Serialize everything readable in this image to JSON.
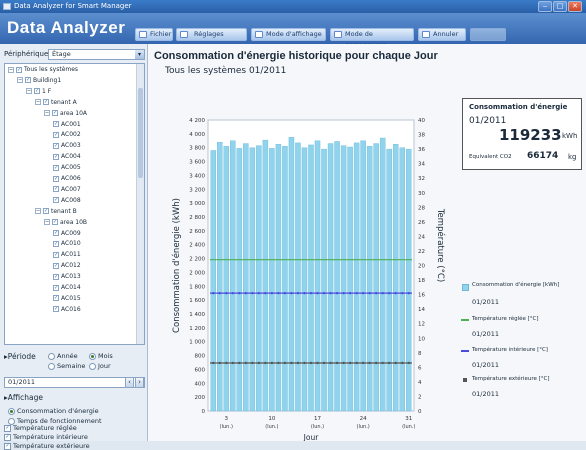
{
  "window": {
    "title": "Data Analyzer for Smart Manager"
  },
  "app": {
    "title": "Data Analyzer"
  },
  "toolbar": {
    "fichier": "Fichier",
    "reglages": "Réglages",
    "mode_affichage": "Mode d'affichage",
    "mode_comparaison": "Mode de comparaison",
    "annuler": "Annuler"
  },
  "sidebar": {
    "peripherique_label": "Périphérique",
    "peripherique_value": "Étage",
    "tree": [
      {
        "label": "Tous les systèmes",
        "level": 0
      },
      {
        "label": "Building1",
        "level": 1
      },
      {
        "label": "1 F",
        "level": 2
      },
      {
        "label": "tenant A",
        "level": 3
      },
      {
        "label": "area 10A",
        "level": 4
      },
      {
        "label": "AC001",
        "level": 5
      },
      {
        "label": "AC002",
        "level": 5
      },
      {
        "label": "AC003",
        "level": 5
      },
      {
        "label": "AC004",
        "level": 5
      },
      {
        "label": "AC005",
        "level": 5
      },
      {
        "label": "AC006",
        "level": 5
      },
      {
        "label": "AC007",
        "level": 5
      },
      {
        "label": "AC008",
        "level": 5
      },
      {
        "label": "tenant B",
        "level": 3
      },
      {
        "label": "area 10B",
        "level": 4
      },
      {
        "label": "AC009",
        "level": 5
      },
      {
        "label": "AC010",
        "level": 5
      },
      {
        "label": "AC011",
        "level": 5
      },
      {
        "label": "AC012",
        "level": 5
      },
      {
        "label": "AC013",
        "level": 5
      },
      {
        "label": "AC014",
        "level": 5
      },
      {
        "label": "AC015",
        "level": 5
      },
      {
        "label": "AC016",
        "level": 5
      }
    ],
    "periode_label": "Période",
    "periode_options": [
      "Année",
      "Mois",
      "Semaine",
      "Jour"
    ],
    "periode_selected": "Mois",
    "date_value": "01/2011",
    "affichage_label": "Affichage",
    "affichage_options": [
      "Consommation d'énergie",
      "Temps de fonctionnement"
    ],
    "affichage_selected": "Consommation d'énergie",
    "checkboxes": [
      {
        "label": "Température réglée",
        "checked": true
      },
      {
        "label": "Température intérieure",
        "checked": true
      },
      {
        "label": "Température extérieure",
        "checked": true
      }
    ]
  },
  "main": {
    "title": "Consommation d'énergie historique pour chaque Jour",
    "subtitle": "Tous les systèmes  01/2011"
  },
  "consumption_box": {
    "heading": "Consommation d'énergie",
    "period": "01/2011",
    "value": "119233",
    "unit": "kWh",
    "co2_label": "Equivalent CO2",
    "co2_value": "66174",
    "co2_unit": "kg"
  },
  "legend": [
    {
      "label": "Consommation d'énergie [kWh]",
      "date": "01/2011"
    },
    {
      "label": "Température réglée [°C]",
      "date": "01/2011"
    },
    {
      "label": "Température intérieure [°C]",
      "date": "01/2011"
    },
    {
      "label": "Température extérieure [°C]",
      "date": "01/2011"
    }
  ],
  "colors": {
    "bar": "#8fd3ec",
    "bar_edge": "#6fb9d8",
    "setpoint_line": "#4caf50",
    "indoor_line": "#4a4adf",
    "outdoor_line": "#555555",
    "header_blue": "#3f72b8"
  },
  "chart_data": {
    "type": "bar",
    "xlabel": "Jour",
    "ylabel": "Consommation d'énergie (kWh)",
    "y2label": "Température (°C)",
    "ylim": [
      0,
      4200
    ],
    "y2lim": [
      0,
      40
    ],
    "yticks": [
      "4 200",
      "4 000",
      "3 800",
      "3 600",
      "3 400",
      "3 200",
      "3 000",
      "2 800",
      "2 600",
      "2 400",
      "2 200",
      "2 000",
      "1 800",
      "1 600",
      "1 400",
      "1 200",
      "1 000",
      "800",
      "600",
      "400",
      "200",
      "0"
    ],
    "y2ticks": [
      "40",
      "38",
      "36",
      "34",
      "32",
      "30",
      "28",
      "26",
      "24",
      "22",
      "20",
      "18",
      "16",
      "14",
      "12",
      "10",
      "8",
      "6",
      "4",
      "2",
      "0"
    ],
    "xticks": [
      {
        "day": 3,
        "label": "3",
        "weekday": "(lun.)"
      },
      {
        "day": 10,
        "label": "10",
        "weekday": "(lun.)"
      },
      {
        "day": 17,
        "label": "17",
        "weekday": "(lun.)"
      },
      {
        "day": 24,
        "label": "24",
        "weekday": "(lun.)"
      },
      {
        "day": 31,
        "label": "31",
        "weekday": "(lun.)"
      }
    ],
    "categories": [
      1,
      2,
      3,
      4,
      5,
      6,
      7,
      8,
      9,
      10,
      11,
      12,
      13,
      14,
      15,
      16,
      17,
      18,
      19,
      20,
      21,
      22,
      23,
      24,
      25,
      26,
      27,
      28,
      29,
      30,
      31
    ],
    "series": [
      {
        "name": "Consommation d'énergie [kWh]",
        "type": "bar",
        "values": [
          3760,
          3880,
          3820,
          3900,
          3790,
          3860,
          3800,
          3830,
          3910,
          3790,
          3850,
          3820,
          3950,
          3870,
          3800,
          3840,
          3900,
          3780,
          3860,
          3890,
          3830,
          3810,
          3870,
          3900,
          3820,
          3860,
          3940,
          3780,
          3850,
          3800,
          3780
        ]
      },
      {
        "name": "Température réglée [°C]",
        "type": "line",
        "axis": "y2",
        "value": 20.8
      },
      {
        "name": "Température intérieure [°C]",
        "type": "line",
        "axis": "y2",
        "value": 16.2
      },
      {
        "name": "Température extérieure [°C]",
        "type": "line",
        "axis": "y2",
        "value": 6.6
      }
    ]
  }
}
